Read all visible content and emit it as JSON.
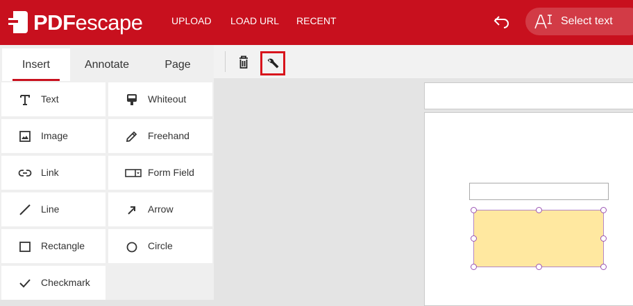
{
  "header": {
    "logo": {
      "pdf": "PDF",
      "escape": "escape"
    },
    "nav": [
      "UPLOAD",
      "LOAD URL",
      "RECENT"
    ],
    "undo_icon": "undo-icon",
    "select_text_label": "Select text",
    "select_text_icon": "text-cursor-icon",
    "brand_color": "#c8101e"
  },
  "tabs": [
    {
      "label": "Insert",
      "active": true
    },
    {
      "label": "Annotate",
      "active": false
    },
    {
      "label": "Page",
      "active": false
    }
  ],
  "tools": [
    {
      "label": "Text",
      "icon": "text-icon"
    },
    {
      "label": "Whiteout",
      "icon": "whiteout-icon"
    },
    {
      "label": "Image",
      "icon": "image-icon"
    },
    {
      "label": "Freehand",
      "icon": "pencil-icon"
    },
    {
      "label": "Link",
      "icon": "link-icon"
    },
    {
      "label": "Form Field",
      "icon": "form-field-icon"
    },
    {
      "label": "Line",
      "icon": "line-icon"
    },
    {
      "label": "Arrow",
      "icon": "arrow-icon"
    },
    {
      "label": "Rectangle",
      "icon": "rectangle-icon"
    },
    {
      "label": "Circle",
      "icon": "circle-icon"
    },
    {
      "label": "Checkmark",
      "icon": "checkmark-icon"
    }
  ],
  "toolbar": {
    "delete_icon": "trash-icon",
    "properties_icon": "wrench-icon",
    "highlight_color": "#d8141c"
  },
  "annotation": {
    "fill_color": "#ffe8a0",
    "selection_color": "#9a52b3"
  }
}
